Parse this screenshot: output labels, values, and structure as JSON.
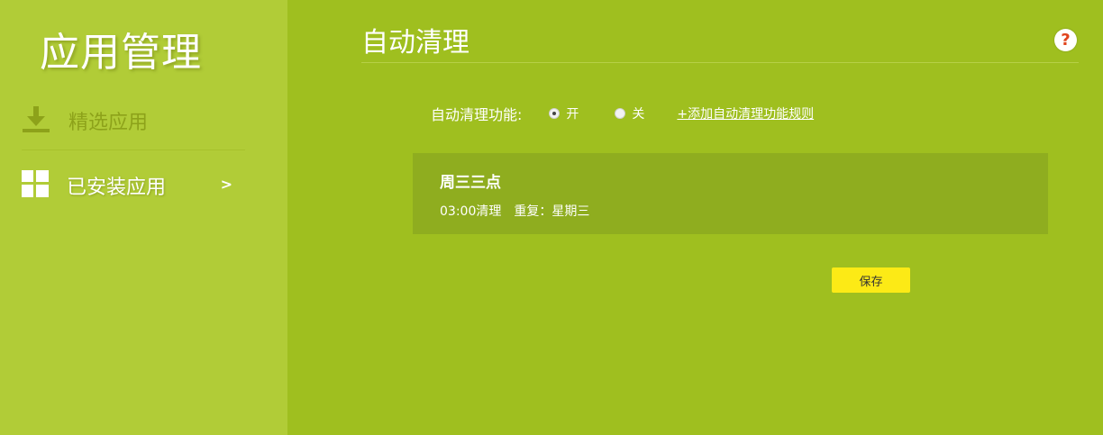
{
  "sidebar": {
    "title": "应用管理",
    "items": [
      {
        "label": "精选应用",
        "icon": "download-icon"
      },
      {
        "label": "已安装应用",
        "icon": "grid-icon",
        "chevron": ">"
      }
    ]
  },
  "main": {
    "title": "自动清理",
    "help_icon": "?",
    "auto_clean": {
      "label": "自动清理功能:",
      "options": [
        "开",
        "关"
      ],
      "selected": "开",
      "add_rule_link": "+添加自动清理功能规则"
    },
    "rules": [
      {
        "name": "周三三点",
        "time": "03:00清理",
        "repeat": "重复：星期三"
      }
    ],
    "save_label": "保存"
  },
  "colors": {
    "main_bg": "#9fbf1f",
    "sidebar_bg": "#b1cc37",
    "card_bg": "#8fad1f",
    "save_button": "#fcea16",
    "help_icon": "#e0431c"
  }
}
